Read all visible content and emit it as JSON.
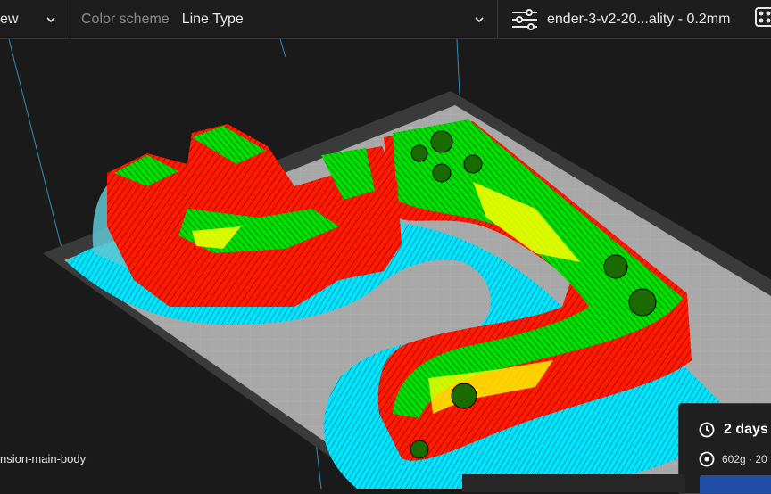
{
  "toolbar": {
    "view_label": "ew",
    "color_scheme_label": "Color scheme",
    "color_scheme_value": "Line Type",
    "profile_name": "ender-3-v2-20...ality - 0.2mm"
  },
  "object_name": "nsion-main-body",
  "print_info": {
    "time": "2 days",
    "material": "602g · 20"
  },
  "colors": {
    "wall_outer": "#ff1a00",
    "wall_inner": "#00e000",
    "infill": "#ffff00",
    "support": "#00e5ff",
    "build_plate": "#a8a8a8",
    "accent_button": "#1f4fa8"
  },
  "icons": {
    "settings": "sliders-icon",
    "extensions": "puzzle-icon",
    "time": "clock-icon",
    "material": "spool-icon"
  }
}
